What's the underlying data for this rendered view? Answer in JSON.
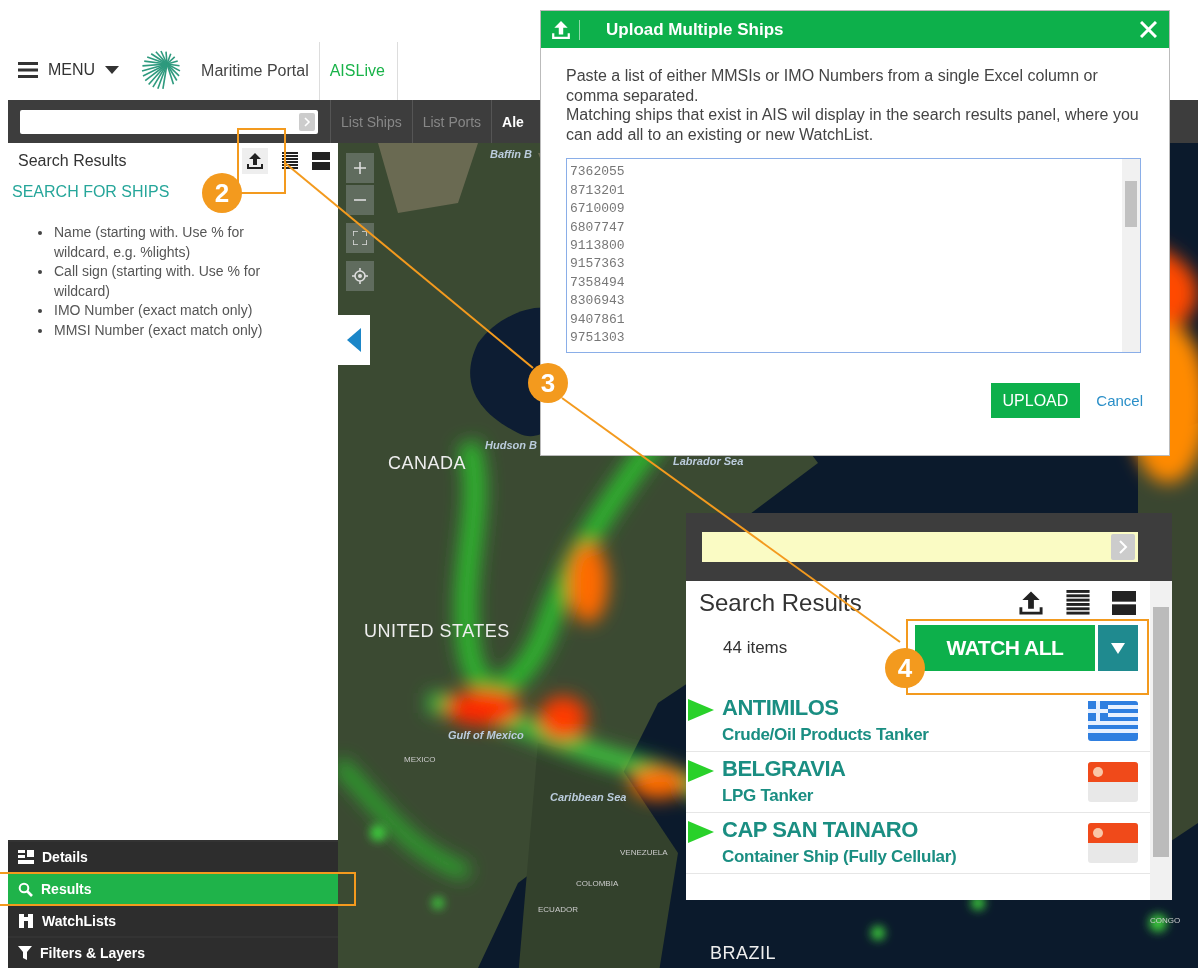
{
  "header": {
    "menu_label": "MENU",
    "portal_name": "Maritime Portal",
    "app_name": "AISLive"
  },
  "toolbar": {
    "tabs": [
      {
        "label": "List Ships",
        "selected": false
      },
      {
        "label": "List Ports",
        "selected": false
      },
      {
        "label": "Ale",
        "selected": true
      }
    ]
  },
  "sidebar": {
    "title": "Search Results",
    "link": "SEARCH FOR SHIPS",
    "hints": [
      "Name (starting with. Use % for wildcard, e.g. %lights)",
      "Call sign (starting with. Use % for wildcard)",
      "IMO Number (exact match only)",
      "MMSI Number (exact match only)"
    ],
    "nav": [
      {
        "label": "Details",
        "selected": false
      },
      {
        "label": "Results",
        "selected": true
      },
      {
        "label": "WatchLists",
        "selected": false
      },
      {
        "label": "Filters & Layers",
        "selected": false
      }
    ]
  },
  "map": {
    "labels": [
      {
        "text": "Baffin B",
        "kind": "sea"
      },
      {
        "text": "Hudson B",
        "kind": "sea"
      },
      {
        "text": "CANADA",
        "kind": "country"
      },
      {
        "text": "Labrador Sea",
        "kind": "sea"
      },
      {
        "text": "UNITED STATES",
        "kind": "country"
      },
      {
        "text": "Gulf of Mexico",
        "kind": "sea"
      },
      {
        "text": "MEXICO",
        "kind": "small"
      },
      {
        "text": "Caribbean Sea",
        "kind": "sea"
      },
      {
        "text": "VENEZUELA",
        "kind": "small"
      },
      {
        "text": "COLOMBIA",
        "kind": "small"
      },
      {
        "text": "ECUADOR",
        "kind": "small"
      },
      {
        "text": "BRAZIL",
        "kind": "country"
      },
      {
        "text": "CONGO",
        "kind": "small"
      }
    ]
  },
  "dialog": {
    "title": "Upload Multiple Ships",
    "paragraphs": [
      "Paste a list of either MMSIs or IMO Numbers from a single Excel column or comma separated.",
      "Matching ships that exist in AIS wil display in the search results panel, where you can add all to an existing or new WatchList."
    ],
    "numbers": [
      "7362055",
      "8713201",
      "6710009",
      "6807747",
      "9113800",
      "9157363",
      "7358494",
      "8306943",
      "9407861",
      "9751303"
    ],
    "upload": "UPLOAD",
    "cancel": "Cancel"
  },
  "results_panel": {
    "title": "Search Results",
    "count": "44 items",
    "watch_all": "WATCH ALL",
    "ships": [
      {
        "name": "ANTIMILOS",
        "type": "Crude/Oil Products Tanker"
      },
      {
        "name": "BELGRAVIA",
        "type": "LPG Tanker"
      },
      {
        "name": "CAP SAN TAINARO",
        "type": "Container Ship (Fully Cellular)"
      }
    ]
  },
  "callouts": [
    "2",
    "3",
    "4"
  ]
}
